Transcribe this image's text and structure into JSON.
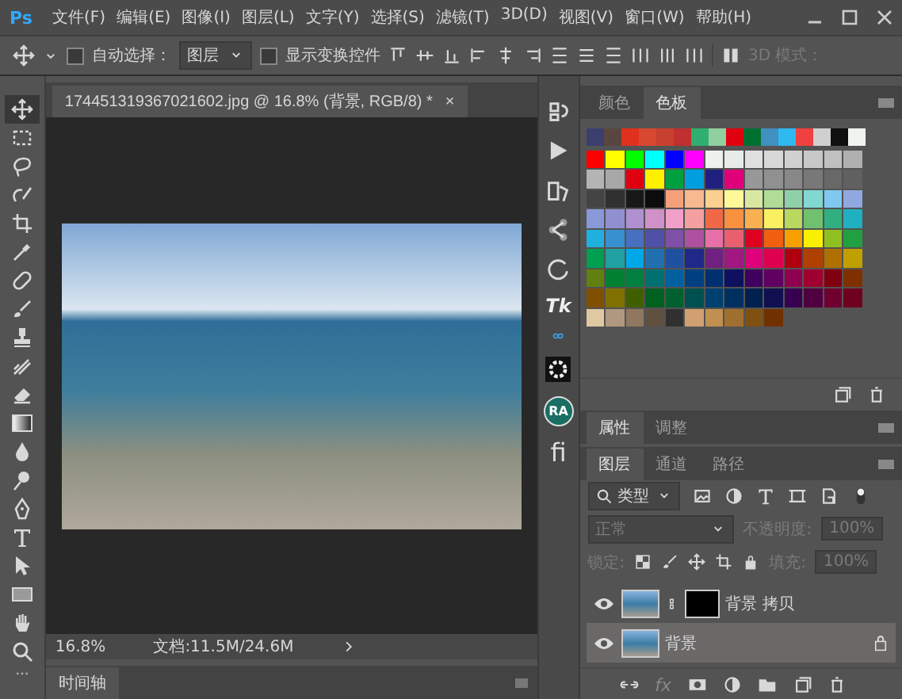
{
  "menu_bar": {
    "logo": "Ps",
    "items": [
      "文件(F)",
      "编辑(E)",
      "图像(I)",
      "图层(L)",
      "文字(Y)",
      "选择(S)",
      "滤镜(T)",
      "3D(D)",
      "视图(V)",
      "窗口(W)",
      "帮助(H)"
    ]
  },
  "options_bar": {
    "auto_select": {
      "label": "自动选择：",
      "checked": false
    },
    "target": {
      "value": "图层"
    },
    "show_transform": {
      "label": "显示变换控件",
      "checked": false
    },
    "mode_3d": {
      "label": "3D 模式：",
      "disabled": true
    }
  },
  "tools": [
    {
      "kind": "move",
      "selected": true
    },
    {
      "kind": "marquee",
      "selected": false
    },
    {
      "kind": "lasso",
      "selected": false
    },
    {
      "kind": "quick_select",
      "selected": false
    },
    {
      "kind": "crop",
      "selected": false
    },
    {
      "kind": "eyedropper",
      "selected": false
    },
    {
      "kind": "healing",
      "selected": false
    },
    {
      "kind": "brush",
      "selected": false
    },
    {
      "kind": "stamp",
      "selected": false
    },
    {
      "kind": "history_brush",
      "selected": false
    },
    {
      "kind": "eraser",
      "selected": false
    },
    {
      "kind": "gradient",
      "selected": false
    },
    {
      "kind": "blur",
      "selected": false
    },
    {
      "kind": "dodge",
      "selected": false
    },
    {
      "kind": "pen",
      "selected": false
    },
    {
      "kind": "type",
      "selected": false
    },
    {
      "kind": "path_select",
      "selected": false
    },
    {
      "kind": "rectangle",
      "selected": false
    },
    {
      "kind": "hand",
      "selected": false
    },
    {
      "kind": "zoom",
      "selected": false
    }
  ],
  "document": {
    "tab_title": "174451319367021602.jpg @ 16.8% (背景, RGB/8) *",
    "close": "×",
    "zoom": "16.8%",
    "doc_info": "文档:11.5M/24.6M"
  },
  "timeline": {
    "tab": "时间轴"
  },
  "dock": {
    "tk": "Tk",
    "ra": "RA",
    "fi": "fi"
  },
  "swatches_panel": {
    "tabs": [
      {
        "label": "颜色",
        "selected": false
      },
      {
        "label": "色板",
        "selected": true
      }
    ],
    "recent": [
      {
        "color": "#3a3f6e"
      },
      {
        "color": "#5a4640"
      },
      {
        "color": "#e0301e"
      },
      {
        "color": "#d84830"
      },
      {
        "color": "#c84030"
      },
      {
        "color": "#c03030"
      },
      {
        "color": "#2fb070"
      },
      {
        "color": "#90d0a0"
      },
      {
        "color": "#e00010"
      },
      {
        "color": "#007030"
      },
      {
        "color": "#4090c0"
      },
      {
        "color": "#30b8f0"
      },
      {
        "color": "#f04040"
      },
      {
        "color": "#d0d0d0"
      },
      {
        "color": "#101010"
      },
      {
        "color": "#f0f4f0"
      }
    ],
    "swatches": [
      {
        "color": "#ff0000"
      },
      {
        "color": "#ffff00"
      },
      {
        "color": "#00ff00"
      },
      {
        "color": "#00ffff"
      },
      {
        "color": "#0000ff"
      },
      {
        "color": "#ff00ff"
      },
      {
        "color": "#eef2ee"
      },
      {
        "color": "#e8ece8"
      },
      {
        "color": "#e0e0e0"
      },
      {
        "color": "#d8d8d8"
      },
      {
        "color": "#d0d0d0"
      },
      {
        "color": "#c8c8c8"
      },
      {
        "color": "#c0c0c0"
      },
      {
        "color": "#b0b0b0"
      },
      {
        "color": "#b4b4b4"
      },
      {
        "color": "#a8a8a8"
      },
      {
        "color": "#e00010"
      },
      {
        "color": "#fff000"
      },
      {
        "color": "#00a040"
      },
      {
        "color": "#00a0e0"
      },
      {
        "color": "#202080"
      },
      {
        "color": "#e0007a"
      },
      {
        "color": "#989898"
      },
      {
        "color": "#909090"
      },
      {
        "color": "#888888"
      },
      {
        "color": "#787878"
      },
      {
        "color": "#686868"
      },
      {
        "color": "#606060"
      },
      {
        "color": "#444444"
      },
      {
        "color": "#303030"
      },
      {
        "color": "#181818"
      },
      {
        "color": "#0c0c0c"
      },
      {
        "color": "#f5a07a"
      },
      {
        "color": "#f8b890"
      },
      {
        "color": "#fcd090"
      },
      {
        "color": "#fff898"
      },
      {
        "color": "#d8e8a0"
      },
      {
        "color": "#b0dc98"
      },
      {
        "color": "#90d0a8"
      },
      {
        "color": "#80d8d0"
      },
      {
        "color": "#80c8f0"
      },
      {
        "color": "#90a8e0"
      },
      {
        "color": "#8898d8"
      },
      {
        "color": "#9090d0"
      },
      {
        "color": "#b090d0"
      },
      {
        "color": "#d090c8"
      },
      {
        "color": "#f0a0c8"
      },
      {
        "color": "#f4a0a0"
      },
      {
        "color": "#f06848"
      },
      {
        "color": "#f89040"
      },
      {
        "color": "#f8b050"
      },
      {
        "color": "#f8f060"
      },
      {
        "color": "#b8d860"
      },
      {
        "color": "#70c070"
      },
      {
        "color": "#30b080"
      },
      {
        "color": "#20b0c0"
      },
      {
        "color": "#20b0e0"
      },
      {
        "color": "#3890d0"
      },
      {
        "color": "#4870c0"
      },
      {
        "color": "#5050a8"
      },
      {
        "color": "#8050a8"
      },
      {
        "color": "#b050a0"
      },
      {
        "color": "#e870a8"
      },
      {
        "color": "#e86070"
      },
      {
        "color": "#e00020"
      },
      {
        "color": "#f06010"
      },
      {
        "color": "#f8a000"
      },
      {
        "color": "#f8f000"
      },
      {
        "color": "#90c020"
      },
      {
        "color": "#20a040"
      },
      {
        "color": "#00a050"
      },
      {
        "color": "#20a0a0"
      },
      {
        "color": "#00a8e8"
      },
      {
        "color": "#2070b0"
      },
      {
        "color": "#2050a0"
      },
      {
        "color": "#202888"
      },
      {
        "color": "#702080"
      },
      {
        "color": "#a01880"
      },
      {
        "color": "#e0007b"
      },
      {
        "color": "#e00050"
      },
      {
        "color": "#b00010"
      },
      {
        "color": "#b04000"
      },
      {
        "color": "#b07000"
      },
      {
        "color": "#c0a000"
      },
      {
        "color": "#608010"
      },
      {
        "color": "#008030"
      },
      {
        "color": "#008040"
      },
      {
        "color": "#007070"
      },
      {
        "color": "#0060a0"
      },
      {
        "color": "#004080"
      },
      {
        "color": "#003070"
      },
      {
        "color": "#101060"
      },
      {
        "color": "#400060"
      },
      {
        "color": "#600060"
      },
      {
        "color": "#900050"
      },
      {
        "color": "#a00030"
      },
      {
        "color": "#800010"
      },
      {
        "color": "#803000"
      },
      {
        "color": "#805000"
      },
      {
        "color": "#807000"
      },
      {
        "color": "#406000"
      },
      {
        "color": "#006020"
      },
      {
        "color": "#006030"
      },
      {
        "color": "#005050"
      },
      {
        "color": "#004070"
      },
      {
        "color": "#003060"
      },
      {
        "color": "#002050"
      },
      {
        "color": "#101050"
      },
      {
        "color": "#380050"
      },
      {
        "color": "#500040"
      },
      {
        "color": "#700030"
      },
      {
        "color": "#700020"
      },
      {
        "color": "#e0c8a0"
      },
      {
        "color": "#b09880"
      },
      {
        "color": "#907860"
      },
      {
        "color": "#605040"
      },
      {
        "color": "#303031"
      },
      {
        "color": "#d0a070"
      },
      {
        "color": "#c09050"
      },
      {
        "color": "#a07030"
      },
      {
        "color": "#805010"
      },
      {
        "color": "#703000"
      }
    ]
  },
  "properties_panel": {
    "tabs": [
      {
        "label": "属性",
        "selected": true
      },
      {
        "label": "调整",
        "selected": false
      }
    ]
  },
  "layers_panel": {
    "tabs": [
      {
        "label": "图层",
        "selected": true
      },
      {
        "label": "通道",
        "selected": false
      },
      {
        "label": "路径",
        "selected": false
      }
    ],
    "filter": {
      "value": "类型"
    },
    "blend": {
      "value": "正常",
      "disabled": true
    },
    "opacity": {
      "label": "不透明度:",
      "value": "100%",
      "disabled": true
    },
    "lock": {
      "label": "锁定:"
    },
    "fill": {
      "label": "填充:",
      "value": "100%",
      "disabled": true
    },
    "layers": [
      {
        "name": "背景 拷贝",
        "visible": true,
        "selected": false,
        "has_mask": true,
        "locked": false
      },
      {
        "name": "背景",
        "visible": true,
        "selected": true,
        "has_mask": false,
        "locked": true
      }
    ],
    "footer_fx": "fx"
  }
}
